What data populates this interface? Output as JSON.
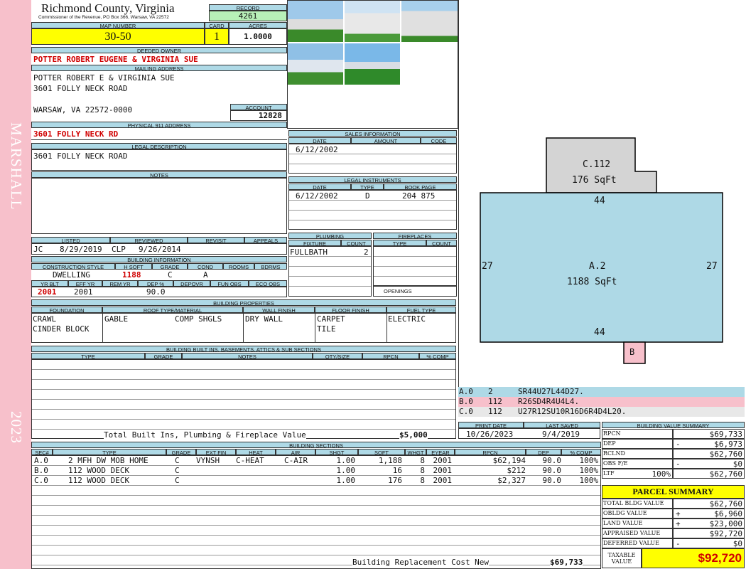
{
  "sidebar": {
    "name": "MARSHALL",
    "year": "2023"
  },
  "header": {
    "county": "Richmond County, Virginia",
    "commissioner": "Commissioner of the Revenue, PO Box 366, Warsaw, VA 22572",
    "record_label": "RECORD",
    "record": "4261"
  },
  "map": {
    "map_label": "MAP NUMBER",
    "map_number": "30-50",
    "card_label": "CARD",
    "card": "1",
    "acres_label": "ACRES",
    "acres": "1.0000"
  },
  "owner": {
    "label": "DEEDED OWNER",
    "name": "POTTER ROBERT EUGENE & VIRGINIA SUE"
  },
  "mailing": {
    "label": "MAILING ADDRESS",
    "line1": "POTTER ROBERT E & VIRGINIA SUE",
    "line2": "3601 FOLLY NECK ROAD",
    "line3": "WARSAW, VA 22572-0000",
    "account_label": "ACCOUNT",
    "account": "12828"
  },
  "physical": {
    "label": "PHYSICAL 911 ADDRESS",
    "address": "3601 FOLLY NECK RD"
  },
  "legal": {
    "label": "LEGAL DESCRIPTION",
    "text": "3601 FOLLY NECK ROAD"
  },
  "notes": {
    "label": "NOTES"
  },
  "review": {
    "listed_label": "LISTED",
    "reviewed_label": "REVIEWED",
    "revisit_label": "REVISIT",
    "appeals_label": "APPEALS",
    "listed_by": "JC",
    "listed_date": "8/29/2019",
    "reviewed_by": "CLP",
    "reviewed_date": "9/26/2014"
  },
  "building_info": {
    "label": "BUILDING INFORMATION",
    "h_cs": "CONSTRUCTION STYLE",
    "h_hsqft": "H SQFT",
    "h_grade": "GRADE",
    "h_cond": "COND",
    "h_rooms": "ROOMS",
    "h_bdrms": "BDRMS",
    "cs": "DWELLING",
    "hsqft": "1188",
    "grade": "C",
    "cond": "A",
    "h_yrblt": "YR BLT",
    "h_effyr": "EFF YR",
    "h_remyr": "REM YR",
    "h_dep": "DEP %",
    "h_depovr": "DEPOVR",
    "h_funobs": "FUN OBS",
    "h_ecoobs": "ECO OBS",
    "yrblt": "2001",
    "effyr": "2001",
    "dep": "90.0"
  },
  "sales": {
    "label": "SALES INFORMATION",
    "h_date": "DATE",
    "h_amount": "AMOUNT",
    "h_code": "CODE",
    "date": "6/12/2002"
  },
  "legal_instruments": {
    "label": "LEGAL INSTRUMENTS",
    "h_date": "DATE",
    "h_type": "TYPE",
    "h_bookpage": "BOOK PAGE",
    "date": "6/12/2002",
    "type": "D",
    "bookpage": "204 875"
  },
  "plumbing": {
    "label": "PLUMBING",
    "h_fixture": "FIXTURE",
    "h_count": "COUNT",
    "fixture": "FULLBATH",
    "count": "2"
  },
  "fireplaces": {
    "label": "FIREPLACES",
    "h_type": "TYPE",
    "h_count": "COUNT",
    "openings_label": "OPENINGS"
  },
  "properties": {
    "label": "BUILDING PROPERTIES",
    "h_foundation": "FOUNDATION",
    "h_roof": "ROOF TYPE/MATERIAL",
    "h_wall": "WALL FINISH",
    "h_floor": "FLOOR FINISH",
    "h_fuel": "FUEL TYPE",
    "foundation1": "CRAWL",
    "foundation2": "CINDER BLOCK",
    "roof_type": "GABLE",
    "roof_material": "COMP SHGLS",
    "wall": "DRY WALL",
    "floor1": "CARPET",
    "floor2": "TILE",
    "fuel": "ELECTRIC"
  },
  "builtins": {
    "label": "BUILDING BUILT INS, BASEMENTS, ATTICS & SUB SECTIONS",
    "h_type": "TYPE",
    "h_grade": "GRADE",
    "h_notes": "NOTES",
    "h_qty": "QTY/SIZE",
    "h_rpcn": "RPCN",
    "h_comp": "% COMP",
    "total_label": "Total Built Ins, Plumbing & Fireplace Value",
    "total": "$5,000"
  },
  "sections": {
    "label": "BUILDING SECTIONS",
    "headers": [
      "SEC#",
      "TYPE",
      "GRADE",
      "EXT FIN",
      "HEAT",
      "AIR",
      "SHGT",
      "SQFT",
      "WHGT",
      "EYEAR",
      "RPCN",
      "DEP",
      "% COMP"
    ],
    "rows": [
      [
        "A.0",
        "2 MFH DW MOB HOME",
        "C",
        "VYNSH",
        "C-HEAT",
        "C-AIR",
        "1.00",
        "1,188",
        "8",
        "2001",
        "$62,194",
        "90.0",
        "100%"
      ],
      [
        "B.0",
        "112 WOOD DECK",
        "C",
        "",
        "",
        "",
        "1.00",
        "16",
        "8",
        "2001",
        "$212",
        "90.0",
        "100%"
      ],
      [
        "C.0",
        "112 WOOD DECK",
        "C",
        "",
        "",
        "",
        "1.00",
        "176",
        "8",
        "2001",
        "$2,327",
        "90.0",
        "100%"
      ]
    ],
    "rcn_label": "Building Replacement Cost New",
    "rcn": "$69,733"
  },
  "sketch": {
    "c_label": "C.112",
    "c_sqft": "176 SqFt",
    "a_label": "A.2",
    "a_sqft": "1188 SqFt",
    "b_label": "B",
    "top": "44",
    "bottom": "44",
    "left": "27",
    "right": "27"
  },
  "sketch_legend": [
    {
      "code": "A.0",
      "num": "2",
      "desc": "SR44U27L44D27.",
      "color": "#aed9e6"
    },
    {
      "code": "B.0",
      "num": "112",
      "desc": "R26SD4R4U4L4.",
      "color": "#f7c0cb"
    },
    {
      "code": "C.0",
      "num": "112",
      "desc": "U27R12SU10R16D6R4D4L20.",
      "color": "#e8e8e8"
    }
  ],
  "dates": {
    "print_label": "PRINT DATE",
    "saved_label": "LAST SAVED",
    "print": "10/26/2023",
    "saved": "9/4/2019"
  },
  "value_summary": {
    "label": "BUILDING VALUE SUMMARY",
    "rows": [
      {
        "k": "RPCN",
        "s": "",
        "v": "$69,733"
      },
      {
        "k": "DEP",
        "s": "-",
        "v": "$6,973"
      },
      {
        "k": "RCLND",
        "s": "",
        "v": "$62,760"
      },
      {
        "k": "OBS F/E",
        "s": "-",
        "v": "$0"
      },
      {
        "k": "LTF",
        "p": "100%",
        "s": "",
        "v": "$62,760"
      }
    ]
  },
  "parcel": {
    "label": "PARCEL SUMMARY",
    "rows": [
      {
        "k": "TOTAL BLDG VALUE",
        "s": "",
        "v": "$62,760"
      },
      {
        "k": "OBLDG VALUE",
        "s": "+",
        "v": "$6,960"
      },
      {
        "k": "LAND VALUE",
        "s": "+",
        "v": "$23,000"
      },
      {
        "k": "APPRAISED VALUE",
        "s": "",
        "v": "$92,720"
      },
      {
        "k": "DEFERRED VALUE",
        "s": "-",
        "v": "$0"
      }
    ],
    "taxable_label": "TAXABLE VALUE",
    "taxable": "$92,720"
  },
  "colors": {
    "accent": "#aed9e6",
    "sidebar": "#f7c0cb",
    "highlight": "#ffff00",
    "record": "#b8f0b8",
    "emphasis": "#d00000"
  }
}
